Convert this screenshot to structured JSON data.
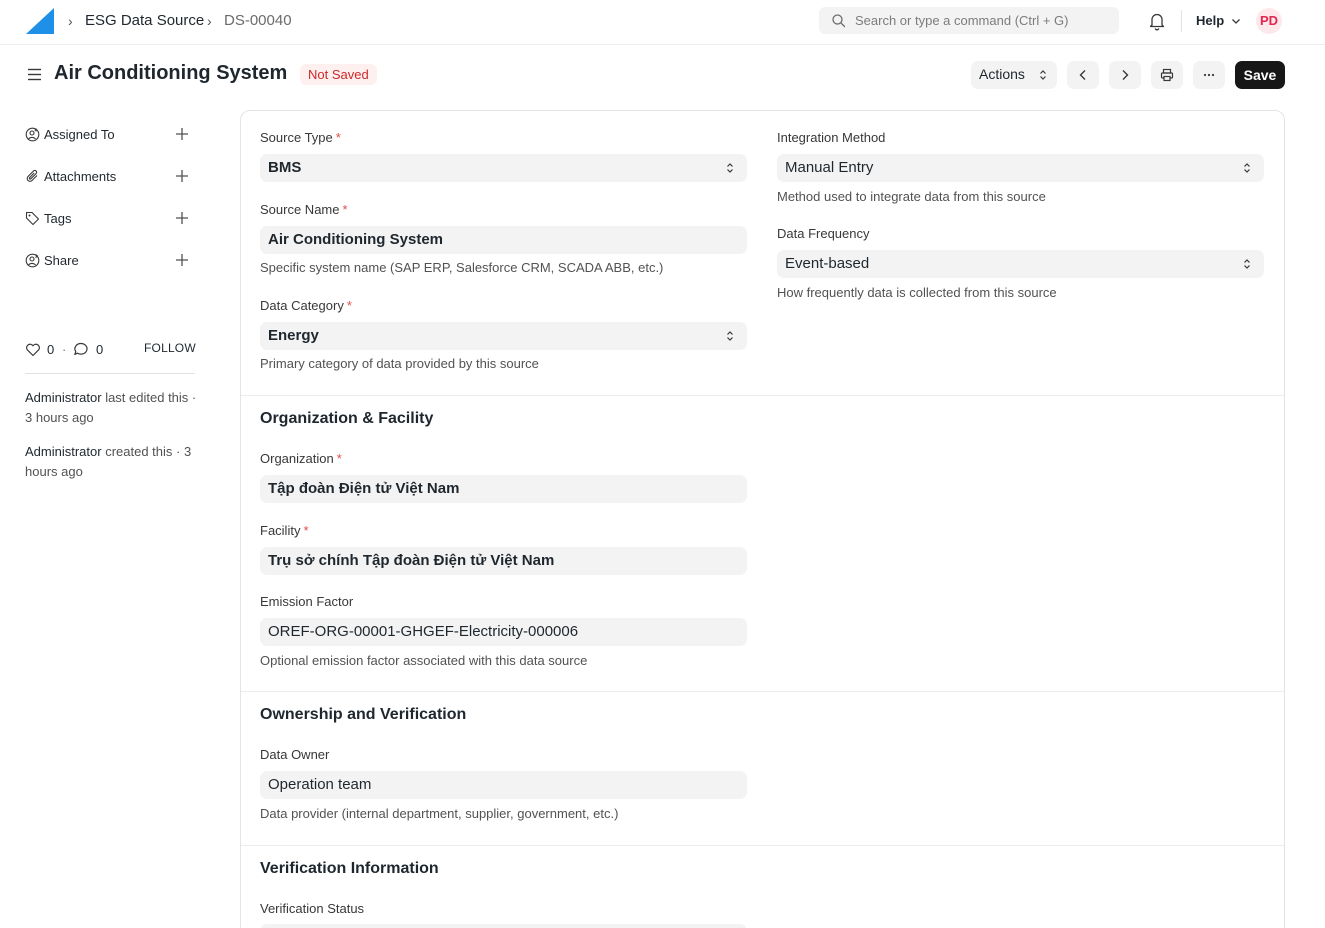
{
  "navbar": {
    "breadcrumbs": [
      "ESG Data Source",
      "DS-00040"
    ],
    "search_placeholder": "Search or type a command (Ctrl + G)",
    "help_label": "Help",
    "avatar_initials": "PD",
    "logo_color": "#1e90e8"
  },
  "page_head": {
    "title": "Air Conditioning System",
    "status_badge": "Not Saved",
    "actions_label": "Actions",
    "save_label": "Save"
  },
  "sidebar": {
    "items": [
      {
        "label": "Assigned To",
        "icon": "user-plus-icon"
      },
      {
        "label": "Attachments",
        "icon": "paperclip-icon"
      },
      {
        "label": "Tags",
        "icon": "tag-icon"
      },
      {
        "label": "Share",
        "icon": "share-user-icon"
      }
    ],
    "likes": "0",
    "comments": "0",
    "follow_label": "FOLLOW",
    "timeline": [
      {
        "who": "Administrator",
        "text": " last edited this · 3 hours ago"
      },
      {
        "who": "Administrator",
        "text": " created this · 3 hours ago"
      }
    ]
  },
  "form": {
    "source_type": {
      "label": "Source Type",
      "value": "BMS"
    },
    "source_name": {
      "label": "Source Name",
      "value": "Air Conditioning System",
      "description": "Specific system name (SAP ERP, Salesforce CRM, SCADA ABB, etc.)"
    },
    "data_category": {
      "label": "Data Category",
      "value": "Energy",
      "description": "Primary category of data provided by this source"
    },
    "integration_method": {
      "label": "Integration Method",
      "value": "Manual Entry",
      "description": "Method used to integrate data from this source"
    },
    "data_frequency": {
      "label": "Data Frequency",
      "value": "Event-based",
      "description": "How frequently data is collected from this source"
    },
    "section_org": "Organization & Facility",
    "organization": {
      "label": "Organization",
      "value": "Tập đoàn Điện tử Việt Nam"
    },
    "facility": {
      "label": "Facility",
      "value": "Trụ sở chính Tập đoàn Điện tử Việt Nam"
    },
    "emission_factor": {
      "label": "Emission Factor",
      "value": "OREF-ORG-00001-GHGEF-Electricity-000006",
      "description": "Optional emission factor associated with this data source"
    },
    "section_ownership": "Ownership and Verification",
    "data_owner": {
      "label": "Data Owner",
      "value": "Operation team",
      "description": "Data provider (internal department, supplier, government, etc.)"
    },
    "section_verification": "Verification Information",
    "verification_status": {
      "label": "Verification Status"
    }
  }
}
